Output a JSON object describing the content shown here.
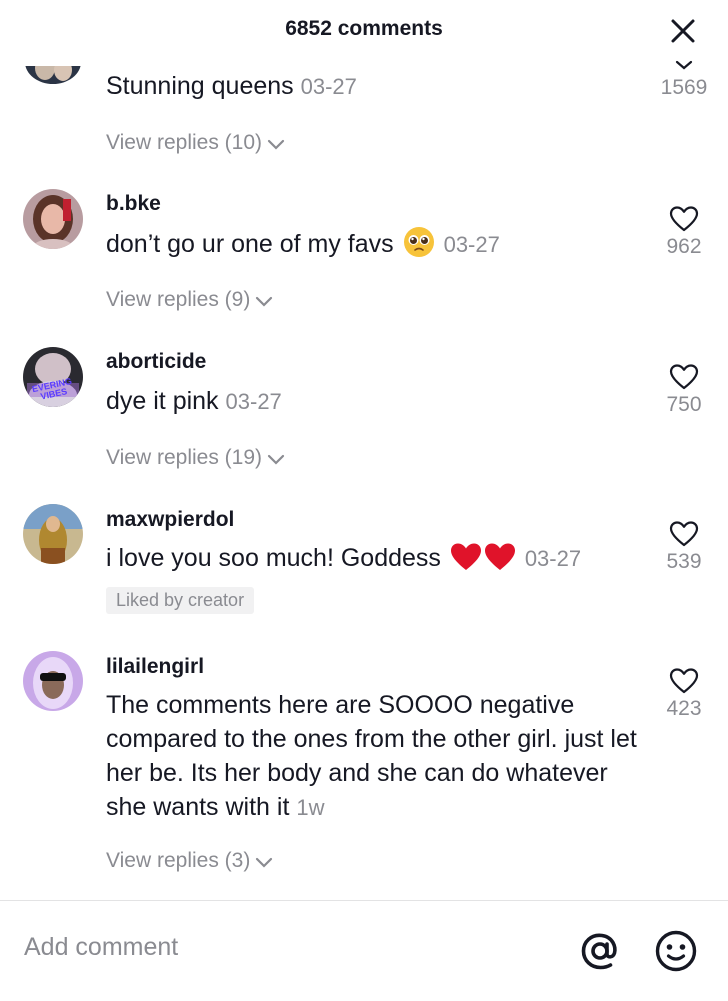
{
  "header": {
    "title": "6852 comments"
  },
  "comments": [
    {
      "username": "",
      "text": "Stunning queens",
      "date": "03-27",
      "likes": "1569",
      "replies_label": "View replies (10)"
    },
    {
      "username": "b.bke",
      "text": "don’t go ur one of my favs",
      "emoji": "pleading-face",
      "date": "03-27",
      "likes": "962",
      "replies_label": "View replies (9)"
    },
    {
      "username": "aborticide",
      "text": "dye it pink",
      "date": "03-27",
      "likes": "750",
      "replies_label": "View replies (19)",
      "avatar_text": "EVERING VIBES"
    },
    {
      "username": "maxwpierdol",
      "text": "i love you soo much! Goddess",
      "emoji": "red-heart",
      "date": "03-27",
      "likes": "539",
      "badge": "Liked by creator"
    },
    {
      "username": "lilailengirl",
      "text": "The comments here are SOOOO negative compared to the ones from the other girl. just let her be. Its her body and she can do whatever she wants with it",
      "date": "1w",
      "likes": "423",
      "replies_label": "View replies (3)"
    }
  ],
  "footer": {
    "placeholder": "Add comment"
  },
  "colors": {
    "text": "#161823",
    "muted": "#8a8b91",
    "heart": "#e0132a"
  },
  "icons": [
    "close-icon",
    "chevron-up-icon",
    "heart-outline-icon",
    "chevron-down-icon",
    "at-icon",
    "smiley-icon",
    "pleading-face-emoji",
    "red-heart-emoji"
  ]
}
